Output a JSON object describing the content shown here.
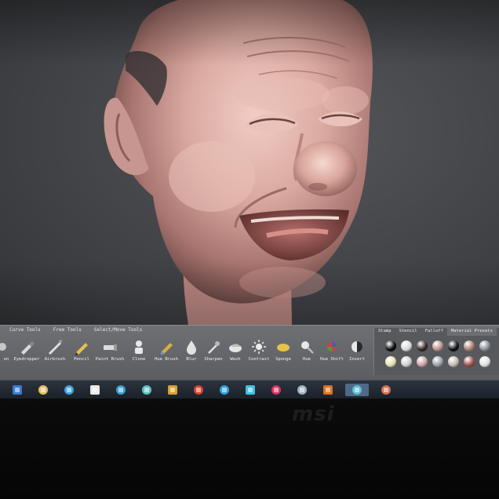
{
  "shelf": {
    "tabs": [
      {
        "label": "Curve Tools",
        "active": false
      },
      {
        "label": "Free Tools",
        "active": false
      },
      {
        "label": "Select/Move Tools",
        "active": false
      }
    ],
    "tools": [
      {
        "label": "Eyedropper",
        "icon": "eyedropper-icon"
      },
      {
        "label": "Airbrush",
        "icon": "airbrush-icon"
      },
      {
        "label": "Pencil",
        "icon": "pencil-icon"
      },
      {
        "label": "Paint Brush",
        "icon": "paint-brush-icon"
      },
      {
        "label": "Clone",
        "icon": "clone-icon"
      },
      {
        "label": "Hue Brush",
        "icon": "hue-brush-icon"
      },
      {
        "label": "Blur",
        "icon": "blur-icon"
      },
      {
        "label": "Sharpen",
        "icon": "sharpen-icon"
      },
      {
        "label": "Wash",
        "icon": "wash-icon"
      },
      {
        "label": "Contrast",
        "icon": "contrast-icon"
      },
      {
        "label": "Sponge",
        "icon": "sponge-icon"
      },
      {
        "label": "Hue",
        "icon": "hue-icon"
      },
      {
        "label": "Hue Shift",
        "icon": "hue-shift-icon"
      },
      {
        "label": "Invert",
        "icon": "invert-icon"
      }
    ]
  },
  "materials": {
    "tabs": [
      {
        "label": "Stamp",
        "active": false
      },
      {
        "label": "Stencil",
        "active": false
      },
      {
        "label": "Falloff",
        "active": false
      },
      {
        "label": "Material Presets",
        "active": true
      }
    ],
    "swatches": [
      "#0d0d0d",
      "#d9d9d9",
      "#3a2a2a",
      "#b89090",
      "#101418",
      "#a88070",
      "#8a9098",
      "#e6dfb0",
      "#cfcfcf",
      "#c9a0a0",
      "#9aa0a8",
      "#c4b8b0",
      "#a05050",
      "#e0e0e0"
    ]
  },
  "taskbar": {
    "items": [
      "start-button",
      "file-explorer-icon",
      "paint-icon",
      "browser-icon",
      "email-icon",
      "image-viewer-icon",
      "archive-icon",
      "chrome-icon",
      "settings-icon",
      "network-icon",
      "media-icon",
      "document-icon",
      "firefox-icon",
      "sculpt-app-icon",
      "photo-app-icon"
    ],
    "active_index": 13
  },
  "monitor": {
    "brand": "msi"
  },
  "colors": {
    "viewport_bg": "#46474b",
    "shelf_bg": "#6a6b6f",
    "skin": "#d8a8a0",
    "taskbar": "#1f2630"
  }
}
